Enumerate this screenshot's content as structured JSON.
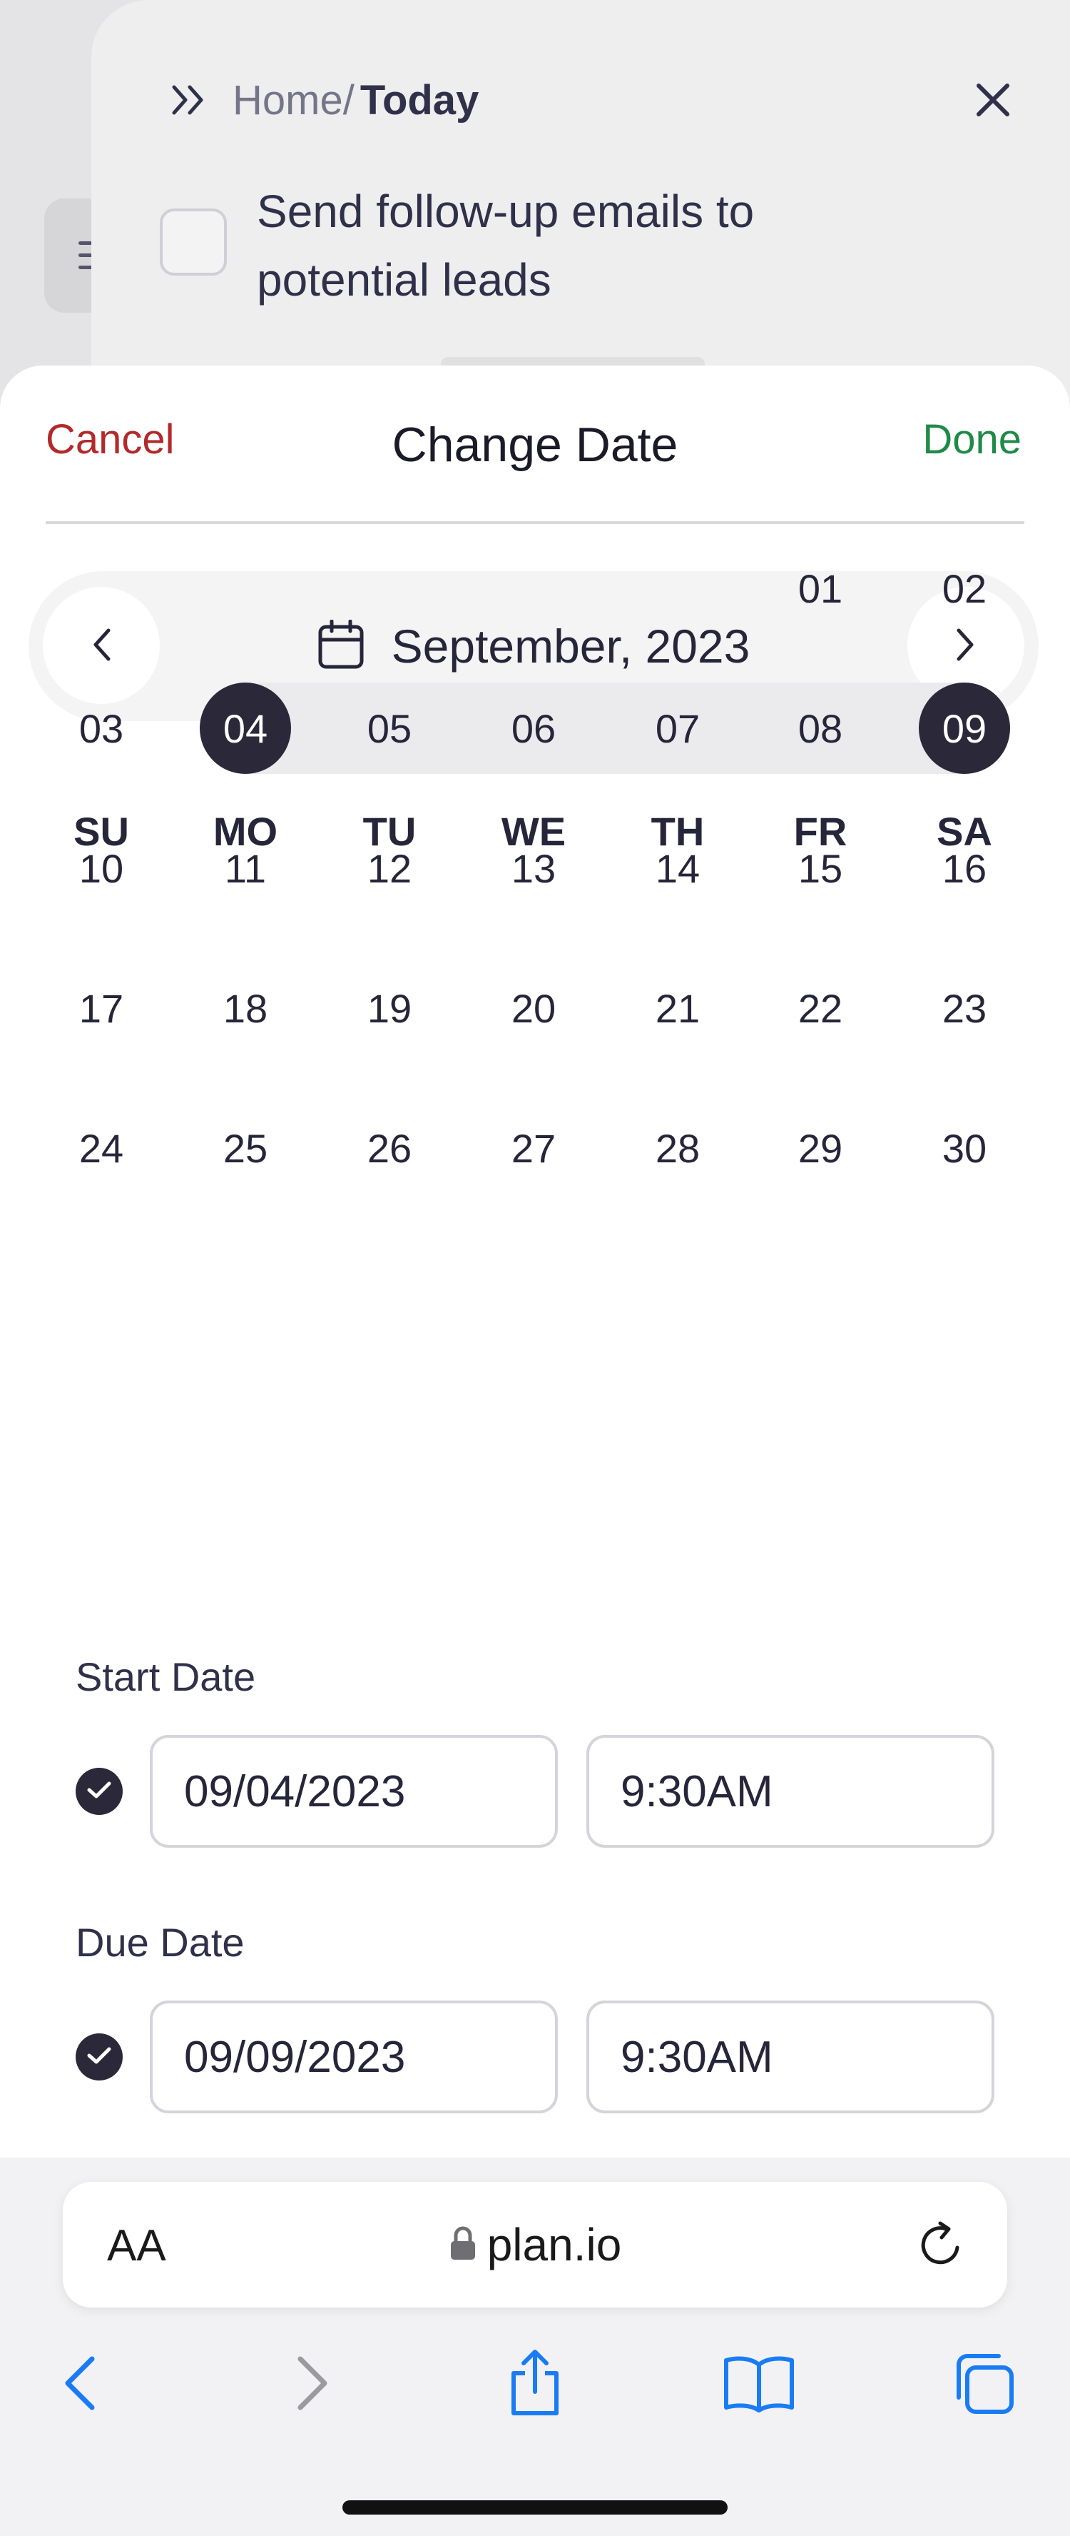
{
  "background_task": {
    "breadcrumb_home": "Home/",
    "breadcrumb_current": "Today",
    "task_title": "Send follow-up emails to potential leads"
  },
  "sheet": {
    "cancel_label": "Cancel",
    "title": "Change Date",
    "done_label": "Done"
  },
  "calendar": {
    "month_label": "September, 2023",
    "weekdays": [
      "SU",
      "MO",
      "TU",
      "WE",
      "TH",
      "FR",
      "SA"
    ],
    "weeks": [
      [
        "",
        "",
        "",
        "",
        "",
        "01",
        "02"
      ],
      [
        "03",
        "04",
        "05",
        "06",
        "07",
        "08",
        "09"
      ],
      [
        "10",
        "11",
        "12",
        "13",
        "14",
        "15",
        "16"
      ],
      [
        "17",
        "18",
        "19",
        "20",
        "21",
        "22",
        "23"
      ],
      [
        "24",
        "25",
        "26",
        "27",
        "28",
        "29",
        "30"
      ]
    ],
    "range_start": "04",
    "range_end": "09"
  },
  "start": {
    "label": "Start Date",
    "date": "09/04/2023",
    "time": "9:30AM"
  },
  "due": {
    "label": "Due Date",
    "date": "09/09/2023",
    "time": "9:30AM"
  },
  "browser": {
    "text_size_label": "AA",
    "url": "plan.io"
  },
  "colors": {
    "cancel": "#b22a2a",
    "done": "#1f8a48",
    "selected_day": "#2a2839",
    "browser_blue": "#1a7cf5"
  }
}
